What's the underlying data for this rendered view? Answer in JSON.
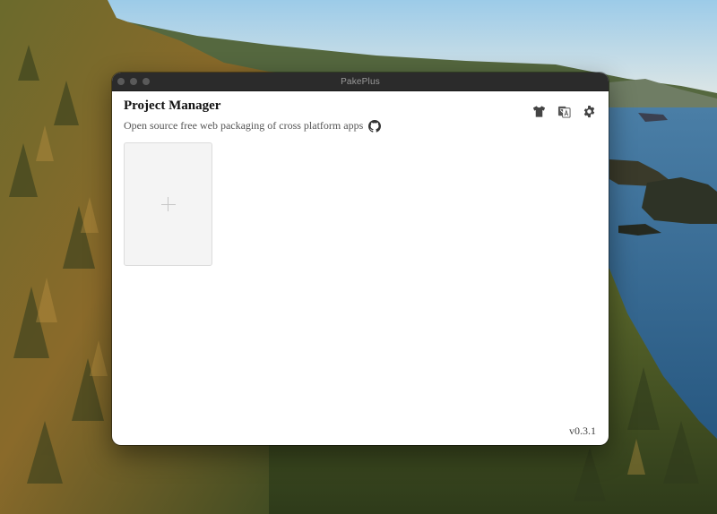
{
  "window": {
    "title": "PakePlus"
  },
  "header": {
    "title": "Project Manager",
    "subtitle": "Open source free web packaging of cross platform apps",
    "github_icon": "github-icon"
  },
  "toolbar": {
    "icons": [
      "tshirt-theme-icon",
      "translate-icon",
      "gear-icon"
    ]
  },
  "projects": {
    "add_card_icon": "plus-icon"
  },
  "footer": {
    "version": "v0.3.1"
  },
  "colors": {
    "titlebar": "#2b2b2b",
    "window_bg": "#ffffff",
    "card_bg": "#f4f4f4",
    "icon": "#444444"
  }
}
